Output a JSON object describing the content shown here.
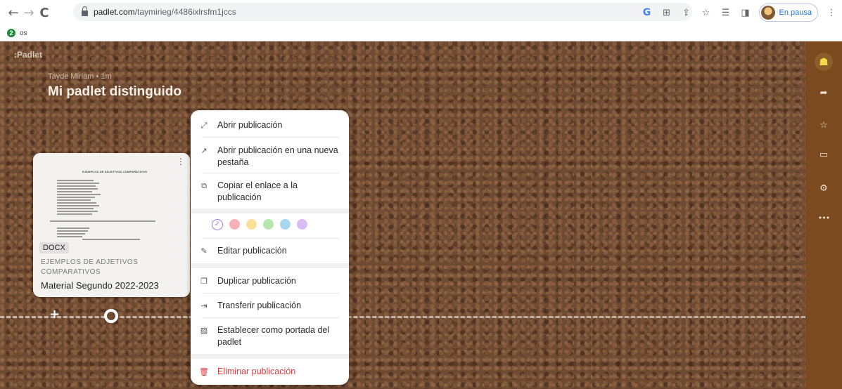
{
  "browser": {
    "back_icon": "←",
    "forward_icon": "→",
    "reload_icon": "C",
    "url_host": "padlet.com",
    "url_path": "/taymirieg/4486ixlrsfm1jccs",
    "profile_label": "En pausa",
    "bookmark_label": "os",
    "bookmark_count": "2",
    "google_icon": "G"
  },
  "padlet": {
    "logo": ":Padlet",
    "author_meta": "Tayde Miriam • 1m",
    "title": "Mi padlet distinguido"
  },
  "card": {
    "doc_title": "EJEMPLOS DE ADJETIVOS COMPARATIVOS",
    "badge": "DOCX",
    "subtitle": "EJEMPLOS DE ADJETIVOS COMPARATIVOS",
    "name": "Material Segundo 2022-2023",
    "menu_icon": "⋮"
  },
  "menu": {
    "open": "Abrir publicación",
    "open_new_tab": "Abrir publicación en una nueva pestaña",
    "copy_link": "Copiar el enlace a la publicación",
    "edit": "Editar publicación",
    "duplicate": "Duplicar publicación",
    "transfer": "Transferir publicación",
    "set_cover": "Establecer como portada del padlet",
    "delete": "Eliminar publicación",
    "colors": [
      "#f7b0b8",
      "#fbe09a",
      "#b6e5b0",
      "#a8d6f0",
      "#d9bdf2"
    ],
    "selected_color": "#9b7cd9",
    "selected_mark": "✓"
  },
  "sidebar": {
    "share_icon": "➦",
    "star_icon": "☆",
    "slideshow_icon": "▭",
    "settings_icon": "⚙",
    "more_icon": "•••",
    "user_icon": "☗"
  },
  "colors": {
    "accent_danger": "#e0393e",
    "sidebar_bg": "#7b4a1e",
    "cork": "#6e4a33"
  }
}
